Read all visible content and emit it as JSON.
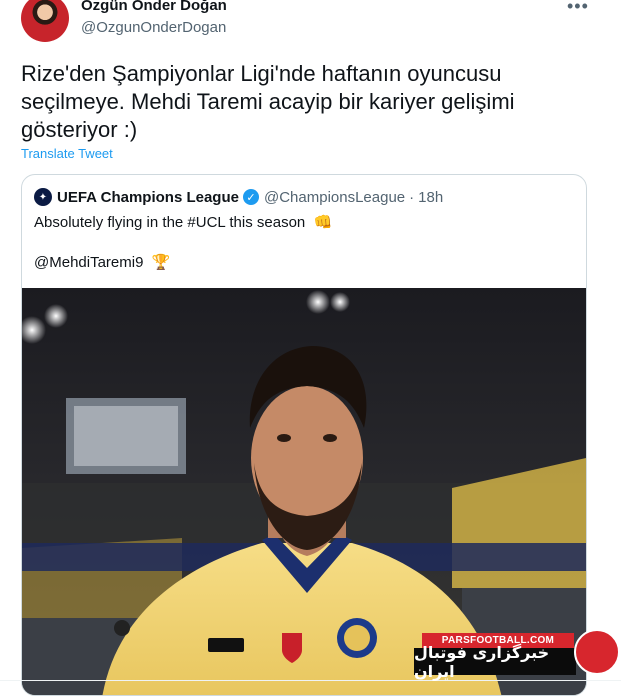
{
  "author": {
    "display_name": "Özgün Önder Doğan",
    "handle": "@OzgunOnderDogan",
    "more_label": "•••"
  },
  "tweet": {
    "text": "Rize'den Şampiyonlar Ligi'nde haftanın oyuncusu seçilmeye. Mehdi Taremi acayip bir kariyer gelişimi gösteriyor :)",
    "translate_label": "Translate Tweet"
  },
  "quoted": {
    "name": "UEFA Champions League",
    "handle": "@ChampionsLeague",
    "separator": "·",
    "time": "18h",
    "text": "Absolutely flying in the #UCL this season",
    "text_emoji": "👊",
    "mention": "@MehdiTaremi9",
    "mention_emoji": "🏆",
    "verified_icon": "verified-badge-icon",
    "logo_icon": "ucl-starball-icon"
  },
  "watermark": {
    "top_text": "PARSFOOTBALL.COM",
    "bottom_text": "خبرگزاری فوتبال ایران"
  },
  "colors": {
    "link": "#1d9bf0",
    "secondary_text": "#536471",
    "jersey": "#f4d77a",
    "stand_yellow": "#e6c34a",
    "watermark_red": "#d7262d"
  }
}
